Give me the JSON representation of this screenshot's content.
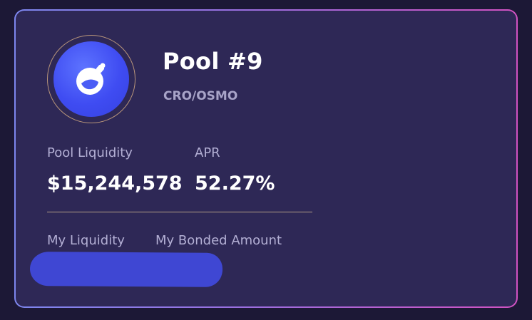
{
  "pool": {
    "title": "Pool #9",
    "pair": "CRO/OSMO",
    "logo_icon": "osmosis-flask-icon"
  },
  "stats": {
    "liquidity_label": "Pool Liquidity",
    "liquidity_value": "$15,244,578",
    "apr_label": "APR",
    "apr_value": "52.27%"
  },
  "my": {
    "liquidity_label": "My Liquidity",
    "bonded_label": "My Bonded Amount"
  },
  "colors": {
    "background": "#1c1836",
    "card": "#2e2856",
    "accent": "#3f47d3",
    "border_gradient_start": "#7d86ee",
    "border_gradient_end": "#d152c2"
  }
}
